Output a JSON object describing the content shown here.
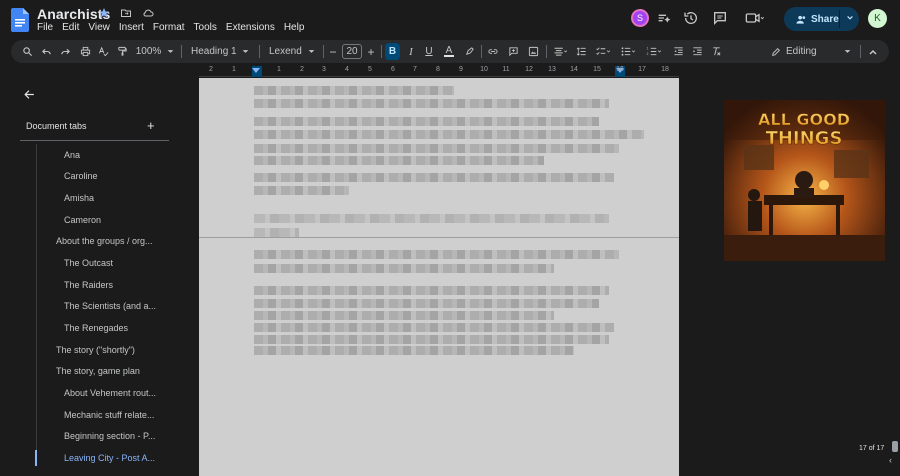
{
  "app": {
    "doc_title": "Anarchists",
    "menu": [
      "File",
      "Edit",
      "View",
      "Insert",
      "Format",
      "Tools",
      "Extensions",
      "Help"
    ],
    "share_label": "Share",
    "collaborator_initial": "S",
    "user_initial": "K"
  },
  "toolbar": {
    "zoom": "100%",
    "style": "Heading 1",
    "font": "Lexend",
    "font_size": "20",
    "mode": "Editing",
    "minus": "−",
    "plus": "+"
  },
  "ruler": {
    "labels": [
      "2",
      "1",
      "",
      "1",
      "2",
      "3",
      "4",
      "5",
      "6",
      "7",
      "8",
      "9",
      "10",
      "11",
      "12",
      "13",
      "14",
      "15",
      "16",
      "17",
      "18"
    ]
  },
  "sidebar": {
    "title": "Document tabs",
    "add": "+",
    "items": [
      {
        "label": "Ana",
        "level": 2
      },
      {
        "label": "Caroline",
        "level": 2
      },
      {
        "label": "Amisha",
        "level": 2
      },
      {
        "label": "Cameron",
        "level": 2
      },
      {
        "label": "About the groups / org...",
        "level": 1
      },
      {
        "label": "The Outcast",
        "level": 2
      },
      {
        "label": "The Raiders",
        "level": 2
      },
      {
        "label": "The Scientists (and a...",
        "level": 2
      },
      {
        "label": "The Renegades",
        "level": 2
      },
      {
        "label": "The story (\"shortly\")",
        "level": 1
      },
      {
        "label": "The story, game plan",
        "level": 1
      },
      {
        "label": "About Vehement rout...",
        "level": 2
      },
      {
        "label": "Mechanic stuff relate...",
        "level": 2
      },
      {
        "label": "Beginning section - P...",
        "level": 2
      },
      {
        "label": "Leaving City - Post A...",
        "level": 2,
        "active": true
      }
    ]
  },
  "cover_image": {
    "title_line1": "ALL GOOD",
    "title_line2": "THINGS"
  },
  "status": {
    "page_count": "17 of 17"
  },
  "colors": {
    "accent": "#8ab4f8",
    "share_bg": "#0e3a5a",
    "page_bg": "#cfcfcf",
    "background": "#1b1b1b"
  }
}
